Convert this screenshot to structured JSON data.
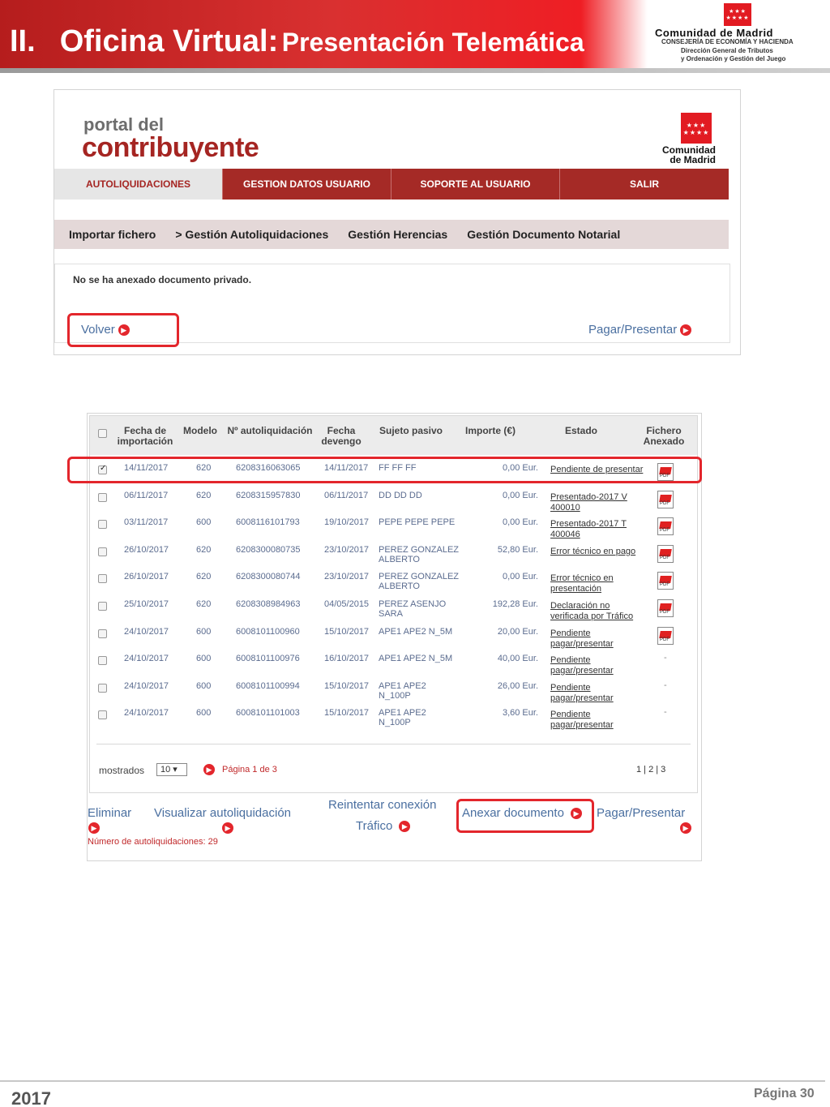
{
  "header": {
    "section_number": "II.",
    "title_main": "Oficina Virtual:",
    "title_sub": "Presentación Telemática",
    "org_name": "Comunidad de Madrid",
    "org_dept1": "CONSEJERÍA DE ECONOMÍA Y HACIENDA",
    "org_dept2": "Dirección General de Tributos",
    "org_dept3": "y Ordenación y Gestión del Juego",
    "brand_color": "#e21b22"
  },
  "portal": {
    "logo_line1": "portal del",
    "logo_line2": "contribuyente",
    "cm_logo": "Comunidad de Madrid",
    "tabs": [
      "AUTOLIQUIDACIONES",
      "GESTION DATOS USUARIO",
      "SOPORTE AL USUARIO",
      "SALIR"
    ],
    "subnav": [
      "Importar fichero",
      "> Gestión Autoliquidaciones",
      "Gestión Herencias",
      "Gestión Documento Notarial"
    ],
    "message": "No se ha anexado documento privado.",
    "back_link": "Volver",
    "pay_link": "Pagar/Presentar"
  },
  "table": {
    "headers": {
      "fecha_import": "Fecha de importación",
      "modelo": "Modelo",
      "num": "Nº autoliquidación",
      "devengo": "Fecha devengo",
      "sujeto": "Sujeto pasivo",
      "importe": "Importe (€)",
      "estado": "Estado",
      "fichero": "Fichero Anexado"
    },
    "rows": [
      {
        "fecha": "14/11/2017",
        "modelo": "620",
        "num": "6208316063065",
        "devengo": "14/11/2017",
        "sujeto": "FF FF FF",
        "importe": "0,00 Eur.",
        "estado": "Pendiente de presentar",
        "pdf": true,
        "checked": true
      },
      {
        "fecha": "06/11/2017",
        "modelo": "620",
        "num": "6208315957830",
        "devengo": "06/11/2017",
        "sujeto": "DD DD DD",
        "importe": "0,00 Eur.",
        "estado": "Presentado-2017 V 400010",
        "pdf": true,
        "checked": false
      },
      {
        "fecha": "03/11/2017",
        "modelo": "600",
        "num": "6008116101793",
        "devengo": "19/10/2017",
        "sujeto": "PEPE PEPE PEPE",
        "importe": "0,00 Eur.",
        "estado": "Presentado-2017 T 400046",
        "pdf": true,
        "checked": false
      },
      {
        "fecha": "26/10/2017",
        "modelo": "620",
        "num": "6208300080735",
        "devengo": "23/10/2017",
        "sujeto": "PEREZ GONZALEZ ALBERTO",
        "importe": "52,80 Eur.",
        "estado": "Error técnico en pago",
        "pdf": true,
        "checked": false
      },
      {
        "fecha": "26/10/2017",
        "modelo": "620",
        "num": "6208300080744",
        "devengo": "23/10/2017",
        "sujeto": "PEREZ GONZALEZ ALBERTO",
        "importe": "0,00 Eur.",
        "estado": "Error técnico en presentación",
        "pdf": true,
        "checked": false
      },
      {
        "fecha": "25/10/2017",
        "modelo": "620",
        "num": "6208308984963",
        "devengo": "04/05/2015",
        "sujeto": "PEREZ ASENJO SARA",
        "importe": "192,28 Eur.",
        "estado": "Declaración no verificada por Tráfico",
        "pdf": true,
        "checked": false
      },
      {
        "fecha": "24/10/2017",
        "modelo": "600",
        "num": "6008101100960",
        "devengo": "15/10/2017",
        "sujeto": "APE1 APE2 N_5M",
        "importe": "20,00 Eur.",
        "estado": "Pendiente pagar/presentar",
        "pdf": true,
        "checked": false
      },
      {
        "fecha": "24/10/2017",
        "modelo": "600",
        "num": "6008101100976",
        "devengo": "16/10/2017",
        "sujeto": "APE1 APE2 N_5M",
        "importe": "40,00 Eur.",
        "estado": "Pendiente pagar/presentar",
        "pdf": false,
        "checked": false
      },
      {
        "fecha": "24/10/2017",
        "modelo": "600",
        "num": "6008101100994",
        "devengo": "15/10/2017",
        "sujeto": "APE1 APE2 N_100P",
        "importe": "26,00 Eur.",
        "estado": "Pendiente pagar/presentar",
        "pdf": false,
        "checked": false
      },
      {
        "fecha": "24/10/2017",
        "modelo": "600",
        "num": "6008101101003",
        "devengo": "15/10/2017",
        "sujeto": "APE1 APE2 N_100P",
        "importe": "3,60 Eur.",
        "estado": "Pendiente pagar/presentar",
        "pdf": false,
        "checked": false
      }
    ],
    "no_file": "-",
    "mostrados_label": "mostrados",
    "page_size": "10 ▾",
    "pagina_text": "Página  1  de 3",
    "pager": "1  |  2  |  3"
  },
  "actions": {
    "eliminar": "Eliminar",
    "visualizar": "Visualizar autoliquidación",
    "reintentar1": "Reintentar conexión",
    "reintentar2": "Tráfico",
    "anexar": "Anexar documento",
    "pagar": "Pagar/Presentar",
    "num_autoliquidaciones": "Número de autoliquidaciones: 29"
  },
  "footer": {
    "year": "2017",
    "page": "Página 30"
  }
}
